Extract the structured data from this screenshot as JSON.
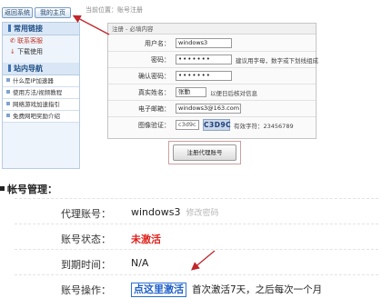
{
  "top_buttons": {
    "home": "返回系统",
    "web": "我的主页"
  },
  "breadcrumb": "当前位置：账号注册",
  "sidebar": {
    "section1": "常用链接",
    "links": [
      {
        "label": "联系客服",
        "icon": "phone-icon"
      },
      {
        "label": "下载使用",
        "icon": "download-icon"
      }
    ],
    "section2": "站内导航",
    "nav": [
      "什么是IP加速器",
      "使用方法/视频教程",
      "网络游戏加速指引",
      "免费网吧奖励介绍"
    ]
  },
  "form": {
    "title": "注册 - 必填内容",
    "username_label": "用户名：",
    "username_value": "windows3",
    "password_label": "密码：",
    "password_value": "•••••••",
    "password_hint": "建议用字母，数字或下划线组成",
    "confirm_label": "确认密码：",
    "confirm_value": "•••••••",
    "realname_label": "真实姓名：",
    "realname_value": "张勤",
    "realname_hint": "以便日后核对信息",
    "email_label": "电子邮箱：",
    "email_value": "windows3@163.com",
    "captcha_label": "图像验证：",
    "captcha_value": "c3d9c",
    "captcha_image": "C3D9C",
    "captcha_hint": "有效字符：23456789",
    "submit_label": "注册代理账号"
  },
  "account": {
    "title": "帐号管理：",
    "rows": [
      {
        "label": "代理账号：",
        "value": "windows3",
        "extra": "修改密码"
      },
      {
        "label": "账号状态：",
        "value": "未激活"
      },
      {
        "label": "到期时间：",
        "value": "N/A"
      },
      {
        "label": "账号操作：",
        "link": "点这里激活",
        "note": "首次激活7天，之后每次一个月"
      }
    ]
  },
  "colors": {
    "accent_red": "#e0231d",
    "link_blue": "#1f5fc9",
    "arrow_red": "#c0262b"
  }
}
